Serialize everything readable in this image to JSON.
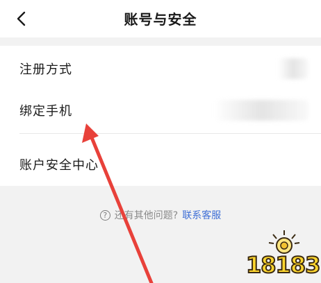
{
  "header": {
    "title": "账号与安全",
    "back_icon": "chevron-left-icon"
  },
  "list": {
    "items": [
      {
        "label": "注册方式"
      },
      {
        "label": "绑定手机"
      },
      {
        "label": "账户安全中心"
      }
    ]
  },
  "help": {
    "icon": "question-circle-icon",
    "question": "还有其他问题?",
    "link": "联系客服"
  },
  "annotation": {
    "arrow_color": "#e8413a"
  },
  "watermark": {
    "text": "18183"
  },
  "colors": {
    "background": "#f2f2f2",
    "card": "#ffffff",
    "link": "#3f6fd6"
  }
}
